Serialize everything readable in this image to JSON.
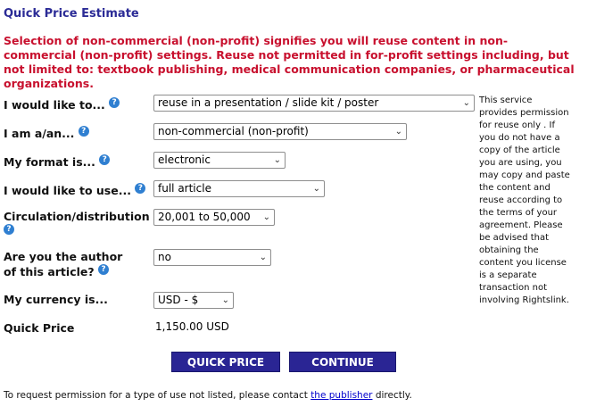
{
  "title": "Quick Price Estimate",
  "warning": "Selection of non-commercial (non-profit) signifies you will reuse content in non-commercial (non-profit) settings. Reuse not permitted in for-profit settings including, but not limited to: textbook publishing, medical communication companies, or pharmaceutical organizations.",
  "help_glyph": "?",
  "chevron_glyph": "⌄",
  "form": {
    "use_label": "I would like to...",
    "use_value": "reuse in a presentation / slide kit / poster",
    "requestor_label": "I am a/an...",
    "requestor_value": "non-commercial (non-profit)",
    "format_label": "My format is...",
    "format_value": "electronic",
    "portion_label": "I would like to use...",
    "portion_value": "full article",
    "circulation_label": "Circulation/distribution",
    "circulation_value": "20,001 to 50,000",
    "author_label_line1": "Are you the author",
    "author_label_line2": "of this article?",
    "author_value": "no",
    "currency_label": "My currency is...",
    "currency_value": "USD - $",
    "price_label": "Quick Price",
    "price_value": "1,150.00 USD"
  },
  "sidebar_note": "This service provides permission for reuse only . If you do not have a copy of the article you are using, you may copy and paste the content and reuse according to the terms of your agreement. Please be advised that obtaining the content you license is a separate transaction not involving Rightslink.",
  "buttons": {
    "quick_price": "QUICK PRICE",
    "continue": "CONTINUE"
  },
  "footer": {
    "prefix": "To request permission for a type of use not listed, please contact",
    "link": "the publisher",
    "suffix": "directly."
  },
  "colors": {
    "title": "#2b2b96",
    "warning": "#c8102e",
    "button": "#2a2594",
    "help_icon": "#2f7fd1",
    "link": "#0000cc"
  }
}
